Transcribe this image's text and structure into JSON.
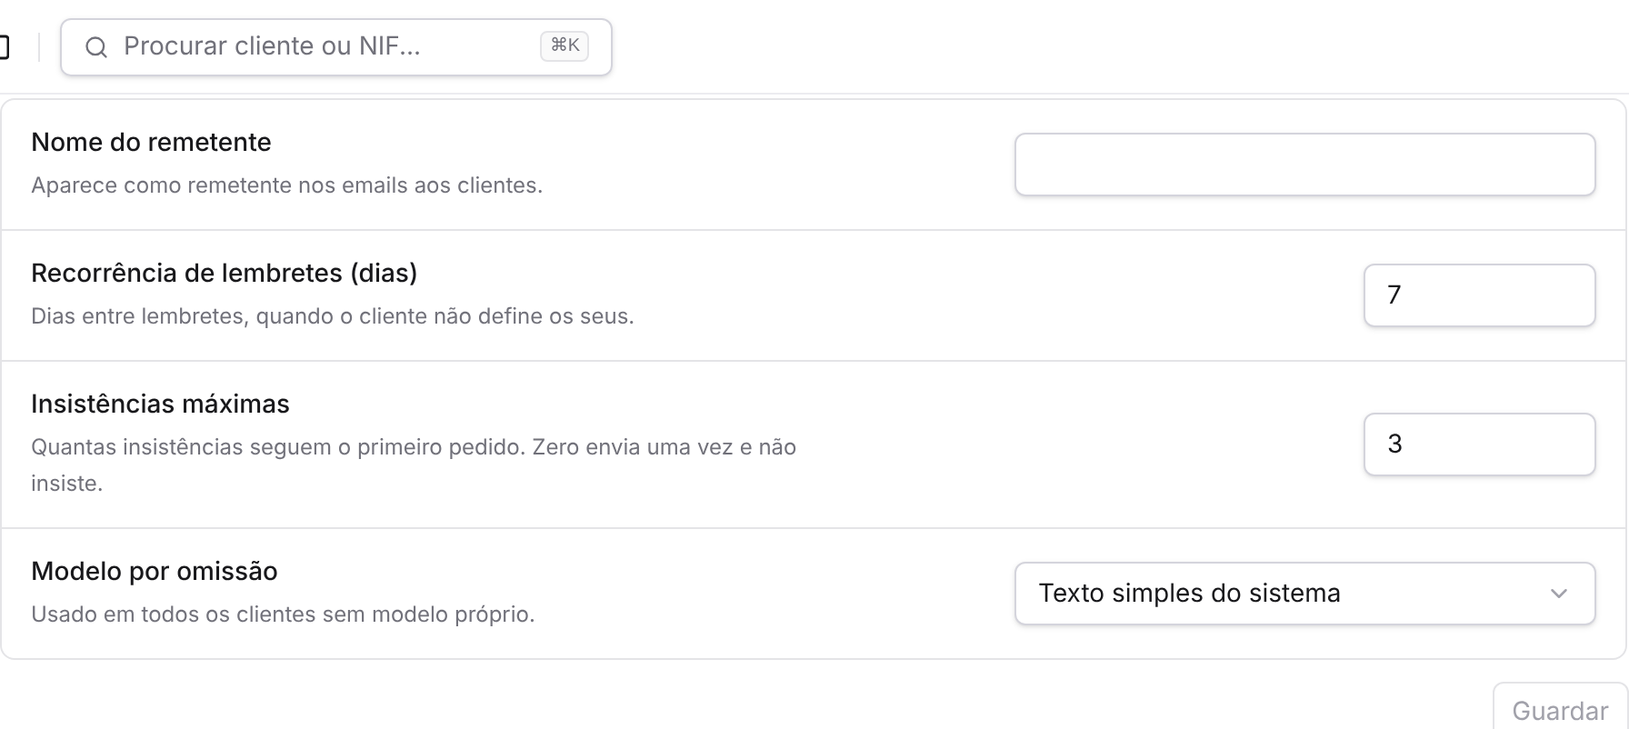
{
  "search": {
    "placeholder": "Procurar cliente ou NIF...",
    "shortcut": "⌘K"
  },
  "settings": [
    {
      "label": "Nome do remetente",
      "description": "Aparece como remetente nos emails aos clientes.",
      "kind": "text"
    },
    {
      "label": "Recorrência de lembretes (dias)",
      "description": "Dias entre lembretes, quando o cliente não define os seus.",
      "kind": "number",
      "value": "7"
    },
    {
      "label": "Insistências máximas",
      "description": "Quantas insistências seguem o primeiro pedido. Zero envia uma vez e não insiste.",
      "kind": "number",
      "value": "3"
    },
    {
      "label": "Modelo por omissão",
      "description": "Usado em todos os clientes sem modelo próprio.",
      "kind": "select",
      "value": "Texto simples do sistema"
    }
  ],
  "save_button": {
    "label": "Guardar",
    "disabled": true
  }
}
